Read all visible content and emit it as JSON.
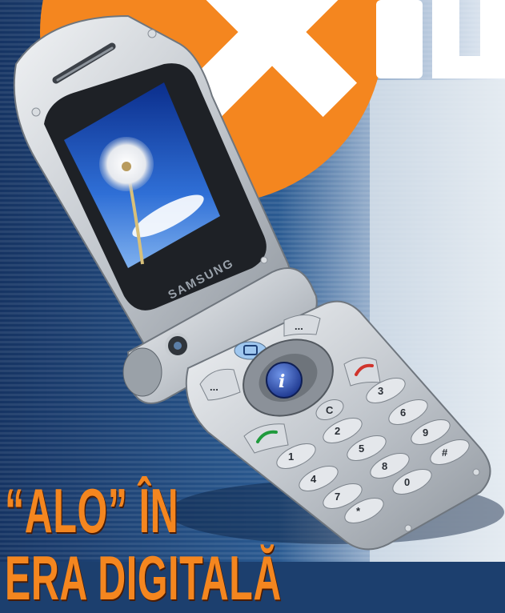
{
  "headline": {
    "line1": "“ALO” ÎN",
    "line2": "ERA DIGITALĂ"
  },
  "phone": {
    "brand": "SAMSUNG",
    "keys": [
      "1",
      "2",
      "3",
      "4",
      "5",
      "6",
      "7",
      "8",
      "9",
      "*",
      "0",
      "#",
      "C"
    ],
    "nav_center_icon": "info-icon",
    "soft_key_left": "...",
    "soft_key_right": "..."
  },
  "colors": {
    "background_blue": "#1c3f6e",
    "stripe_light": "#dfe6ee",
    "logo_orange": "#f4861f",
    "headline_orange": "#f4861f",
    "phone_silver": "#c9ced4",
    "screen_sky": "#2f6fd6",
    "info_button_blue": "#2447a8",
    "call_green": "#1f9a3c",
    "end_red": "#d0342c"
  }
}
